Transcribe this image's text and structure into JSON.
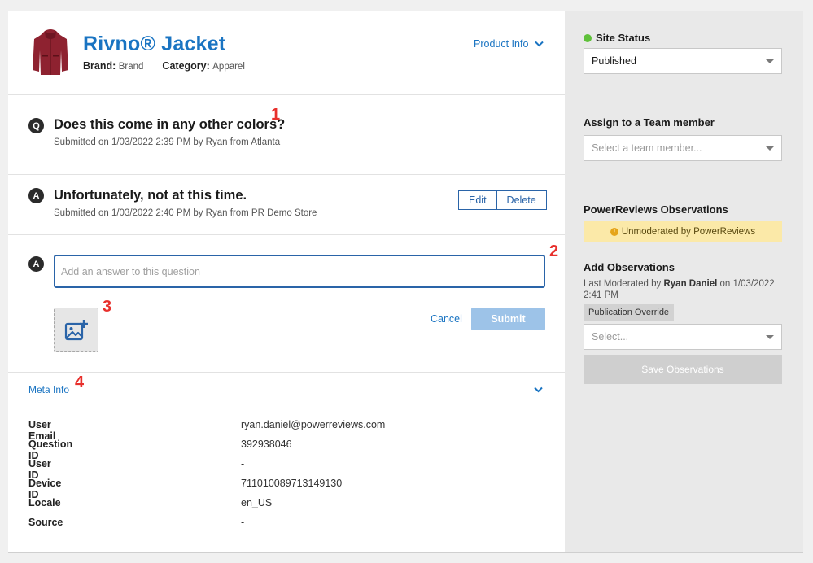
{
  "product": {
    "title": "Rivno® Jacket",
    "brand_label": "Brand:",
    "brand_value": "Brand",
    "category_label": "Category:",
    "category_value": "Apparel",
    "info_link": "Product Info"
  },
  "question": {
    "badge": "Q",
    "text": "Does this come in any other colors?",
    "submitted": "Submitted on 1/03/2022 2:39 PM by Ryan from Atlanta"
  },
  "answer": {
    "badge": "A",
    "text": "Unfortunately, not at this time.",
    "submitted": "Submitted on 1/03/2022 2:40 PM by Ryan from PR Demo Store",
    "edit_label": "Edit",
    "delete_label": "Delete"
  },
  "new_answer": {
    "badge": "A",
    "placeholder": "Add an answer to this question",
    "cancel_label": "Cancel",
    "submit_label": "Submit"
  },
  "meta": {
    "link_label": "Meta Info",
    "rows": [
      {
        "key": "User Email",
        "value": "ryan.daniel@powerreviews.com"
      },
      {
        "key": "Question ID",
        "value": "392938046"
      },
      {
        "key": "User ID",
        "value": "-"
      },
      {
        "key": "Device ID",
        "value": "711010089713149130"
      },
      {
        "key": "Locale",
        "value": "en_US"
      },
      {
        "key": "Source",
        "value": "-"
      }
    ]
  },
  "annotations": [
    "1",
    "2",
    "3",
    "4"
  ],
  "sidebar": {
    "site_status_title": "Site Status",
    "site_status_value": "Published",
    "assign_title": "Assign to a Team member",
    "assign_placeholder": "Select a team member...",
    "observations_title": "PowerReviews Observations",
    "observations_badge_icon": "!",
    "observations_badge": "Unmoderated by PowerReviews",
    "add_obs_title": "Add Observations",
    "last_moderated_prefix": "Last Moderated by",
    "last_moderated_by": "Ryan Daniel",
    "last_moderated_suffix": "on 1/03/2022 2:41 PM",
    "override_tag": "Publication Override",
    "obs_select_placeholder": "Select...",
    "save_obs_label": "Save Observations"
  },
  "colors": {
    "accent": "#1a74c2",
    "annotation_red": "#e8302c",
    "status_green": "#5fc13a",
    "warning_bg": "#fbe9a8"
  }
}
